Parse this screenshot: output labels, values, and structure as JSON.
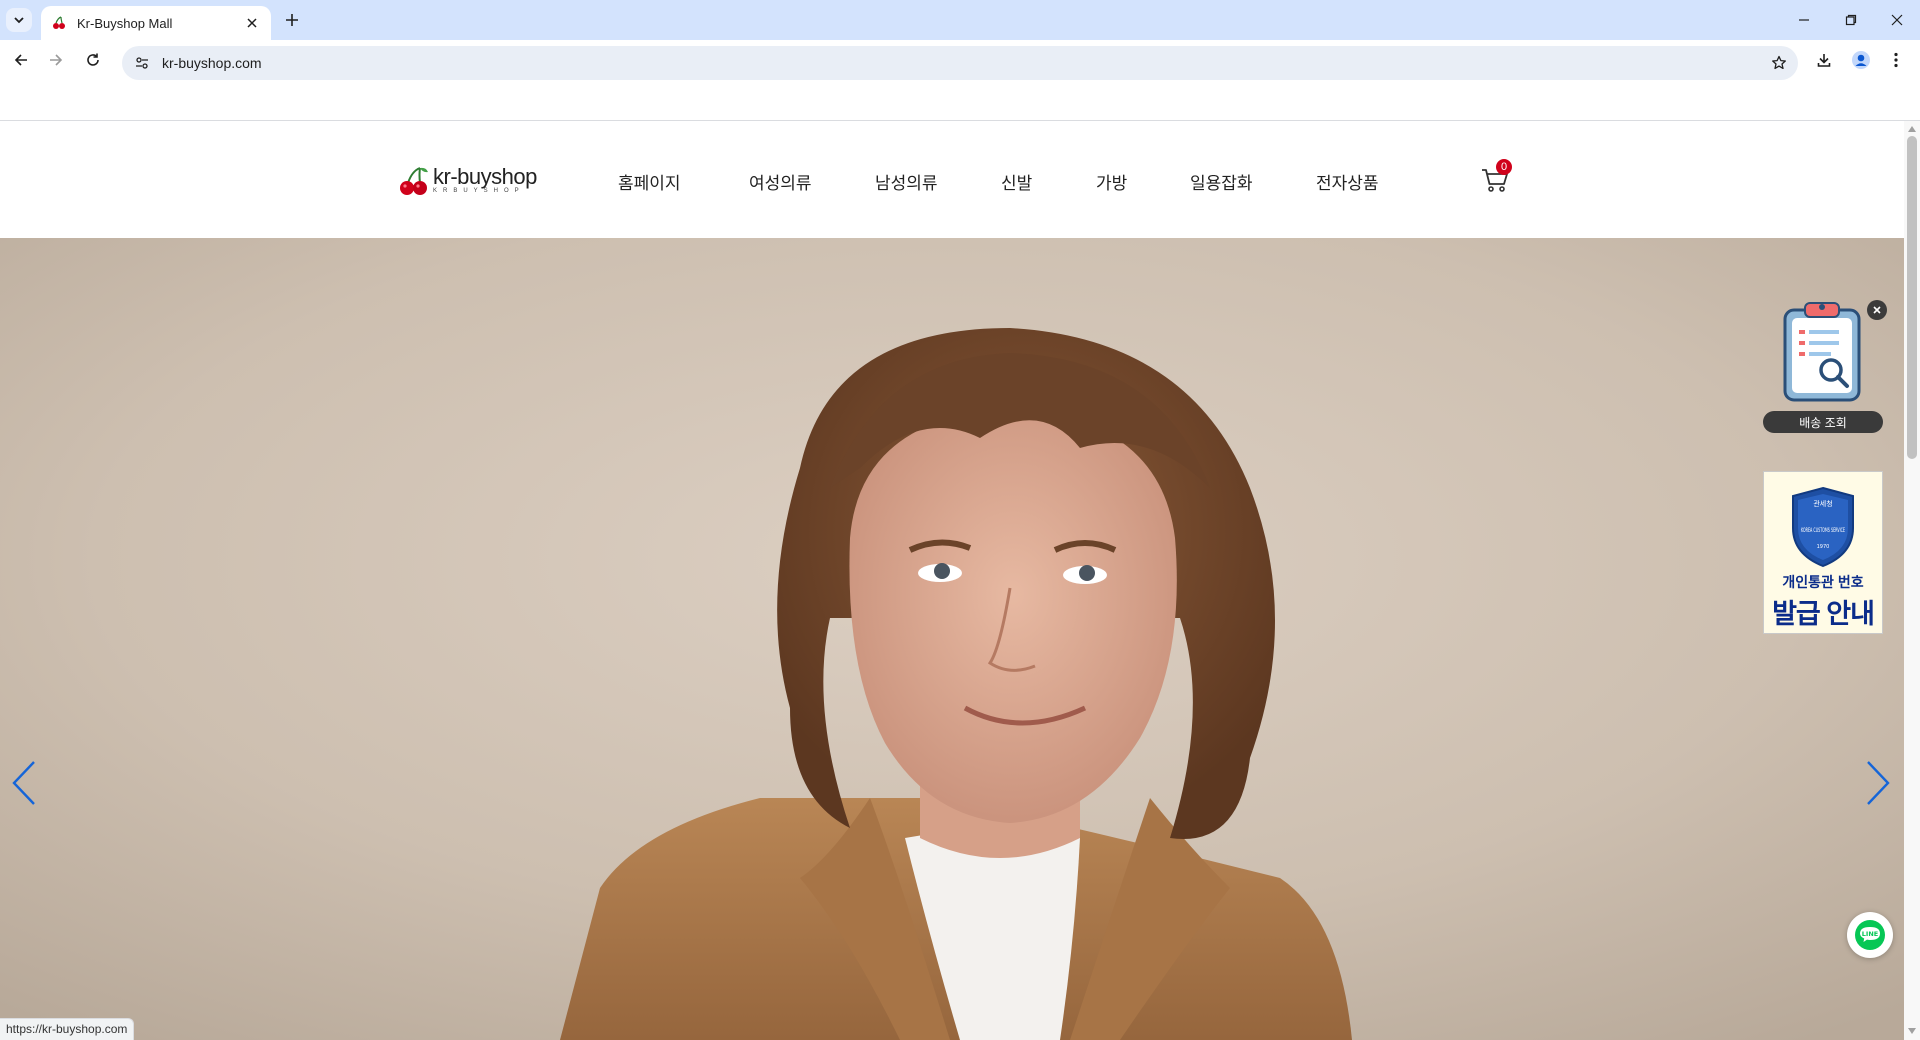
{
  "browser": {
    "tab_title": "Kr-Buyshop Mall",
    "url": "kr-buyshop.com",
    "status_url": "https://kr-buyshop.com"
  },
  "site": {
    "logo_text": "kr-buyshop",
    "logo_sub": "KRBUYSHOP",
    "nav": [
      "홈페이지",
      "여성의류",
      "남성의류",
      "신발",
      "가방",
      "일용잡화",
      "전자상품"
    ],
    "cart_count": "0"
  },
  "widgets": {
    "delivery_label": "배송 조회",
    "customs_agency": "관세청",
    "customs_emblem": "KOREA CUSTOMS SERVICE",
    "customs_year": "1970",
    "customs_line1": "개인통관 번호",
    "customs_line2": "발급 안내",
    "line_label": "LINE"
  },
  "colors": {
    "accent_arrow": "#1565d8",
    "cart_badge": "#d0021b",
    "line_green": "#06c755",
    "customs_blue": "#0b2c8a"
  }
}
